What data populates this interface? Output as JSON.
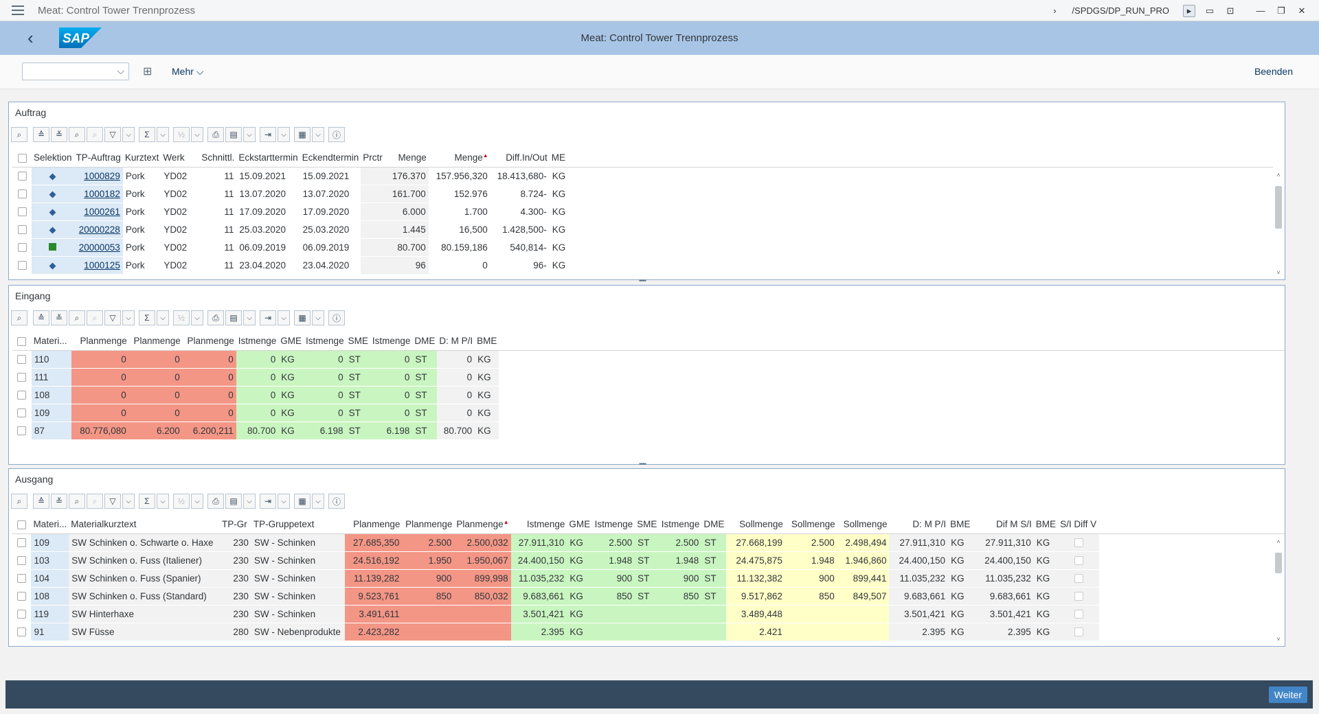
{
  "window": {
    "title": "Meat: Control Tower Trennprozess",
    "transaction": "/SPDGS/DP_RUN_PRO"
  },
  "shell": {
    "app_title": "Meat: Control Tower Trennprozess",
    "logo_text": "SAP"
  },
  "toolbar": {
    "mehr_label": "Mehr",
    "beenden_label": "Beenden"
  },
  "auftrag": {
    "title": "Auftrag",
    "columns": [
      "Selektion",
      "TP-Auftrag",
      "Kurztext",
      "Werk",
      "Schnittl.",
      "Eckstarttermin",
      "Eckendtermin",
      "Prctr",
      "Menge",
      "Menge",
      "Diff.In/Out",
      "ME"
    ],
    "rows": [
      {
        "status": "diamond",
        "tp": "1000829",
        "kurztext": "Pork",
        "werk": "YD02",
        "schnittl": "11",
        "start": "15.09.2021",
        "end": "15.09.2021",
        "prctr": "",
        "menge1": "176.370",
        "menge2": "157.956,320",
        "diff": "18.413,680-",
        "me": "KG"
      },
      {
        "status": "diamond",
        "tp": "1000182",
        "kurztext": "Pork",
        "werk": "YD02",
        "schnittl": "11",
        "start": "13.07.2020",
        "end": "13.07.2020",
        "prctr": "",
        "menge1": "161.700",
        "menge2": "152.976",
        "diff": "8.724-",
        "me": "KG"
      },
      {
        "status": "diamond",
        "tp": "1000261",
        "kurztext": "Pork",
        "werk": "YD02",
        "schnittl": "11",
        "start": "17.09.2020",
        "end": "17.09.2020",
        "prctr": "",
        "menge1": "6.000",
        "menge2": "1.700",
        "diff": "4.300-",
        "me": "KG"
      },
      {
        "status": "diamond",
        "tp": "20000228",
        "kurztext": "Pork",
        "werk": "YD02",
        "schnittl": "11",
        "start": "25.03.2020",
        "end": "25.03.2020",
        "prctr": "",
        "menge1": "1.445",
        "menge2": "16,500",
        "diff": "1.428,500-",
        "me": "KG"
      },
      {
        "status": "square",
        "tp": "20000053",
        "kurztext": "Pork",
        "werk": "YD02",
        "schnittl": "11",
        "start": "06.09.2019",
        "end": "06.09.2019",
        "prctr": "",
        "menge1": "80.700",
        "menge2": "80.159,186",
        "diff": "540,814-",
        "me": "KG"
      },
      {
        "status": "diamond",
        "tp": "1000125",
        "kurztext": "Pork",
        "werk": "YD02",
        "schnittl": "11",
        "start": "23.04.2020",
        "end": "23.04.2020",
        "prctr": "",
        "menge1": "96",
        "menge2": "0",
        "diff": "96-",
        "me": "KG"
      }
    ]
  },
  "eingang": {
    "title": "Eingang",
    "columns": [
      "Materi...",
      "Planmenge",
      "Planmenge",
      "Planmenge",
      "Istmenge",
      "GME",
      "Istmenge",
      "SME",
      "Istmenge",
      "DME",
      "D: M P/I",
      "BME"
    ],
    "rows": [
      {
        "mat": "110",
        "p1": "0",
        "p2": "0",
        "p3": "0",
        "i1": "0",
        "gme": "KG",
        "i2": "0",
        "sme": "ST",
        "i3": "0",
        "dme": "ST",
        "dm": "0",
        "bme": "KG"
      },
      {
        "mat": "111",
        "p1": "0",
        "p2": "0",
        "p3": "0",
        "i1": "0",
        "gme": "KG",
        "i2": "0",
        "sme": "ST",
        "i3": "0",
        "dme": "ST",
        "dm": "0",
        "bme": "KG"
      },
      {
        "mat": "108",
        "p1": "0",
        "p2": "0",
        "p3": "0",
        "i1": "0",
        "gme": "KG",
        "i2": "0",
        "sme": "ST",
        "i3": "0",
        "dme": "ST",
        "dm": "0",
        "bme": "KG"
      },
      {
        "mat": "109",
        "p1": "0",
        "p2": "0",
        "p3": "0",
        "i1": "0",
        "gme": "KG",
        "i2": "0",
        "sme": "ST",
        "i3": "0",
        "dme": "ST",
        "dm": "0",
        "bme": "KG"
      },
      {
        "mat": "87",
        "p1": "80.776,080",
        "p2": "6.200",
        "p3": "6.200,211",
        "i1": "80.700",
        "gme": "KG",
        "i2": "6.198",
        "sme": "ST",
        "i3": "6.198",
        "dme": "ST",
        "dm": "80.700",
        "bme": "KG"
      }
    ]
  },
  "ausgang": {
    "title": "Ausgang",
    "columns": [
      "Materi...",
      "Materialkurztext",
      "TP-Gr",
      "TP-Gruppetext",
      "Planmenge",
      "Planmenge",
      "Planmenge",
      "Istmenge",
      "GME",
      "Istmenge",
      "SME",
      "Istmenge",
      "DME",
      "Sollmenge",
      "Sollmenge",
      "Sollmenge",
      "D: M P/I",
      "BME",
      "Dif M S/I",
      "BME",
      "S/I Diff V"
    ],
    "rows": [
      {
        "mat": "109",
        "text": "SW Schinken o. Schwarte o. Haxe",
        "tpgr": "230",
        "tptext": "SW - Schinken",
        "p1": "27.685,350",
        "p2": "2.500",
        "p3": "2.500,032",
        "i1": "27.911,310",
        "gme": "KG",
        "i2": "2.500",
        "sme": "ST",
        "i3": "2.500",
        "dme": "ST",
        "s1": "27.668,199",
        "s2": "2.500",
        "s3": "2.498,494",
        "dm": "27.911,310",
        "bme": "KG",
        "dif": "27.911,310",
        "bme2": "KG"
      },
      {
        "mat": "103",
        "text": "SW Schinken o. Fuss (Italiener)",
        "tpgr": "230",
        "tptext": "SW - Schinken",
        "p1": "24.516,192",
        "p2": "1.950",
        "p3": "1.950,067",
        "i1": "24.400,150",
        "gme": "KG",
        "i2": "1.948",
        "sme": "ST",
        "i3": "1.948",
        "dme": "ST",
        "s1": "24.475,875",
        "s2": "1.948",
        "s3": "1.946,860",
        "dm": "24.400,150",
        "bme": "KG",
        "dif": "24.400,150",
        "bme2": "KG"
      },
      {
        "mat": "104",
        "text": "SW Schinken o. Fuss (Spanier)",
        "tpgr": "230",
        "tptext": "SW - Schinken",
        "p1": "11.139,282",
        "p2": "900",
        "p3": "899,998",
        "i1": "11.035,232",
        "gme": "KG",
        "i2": "900",
        "sme": "ST",
        "i3": "900",
        "dme": "ST",
        "s1": "11.132,382",
        "s2": "900",
        "s3": "899,441",
        "dm": "11.035,232",
        "bme": "KG",
        "dif": "11.035,232",
        "bme2": "KG"
      },
      {
        "mat": "108",
        "text": "SW Schinken o. Fuss (Standard)",
        "tpgr": "230",
        "tptext": "SW - Schinken",
        "p1": "9.523,761",
        "p2": "850",
        "p3": "850,032",
        "i1": "9.683,661",
        "gme": "KG",
        "i2": "850",
        "sme": "ST",
        "i3": "850",
        "dme": "ST",
        "s1": "9.517,862",
        "s2": "850",
        "s3": "849,507",
        "dm": "9.683,661",
        "bme": "KG",
        "dif": "9.683,661",
        "bme2": "KG"
      },
      {
        "mat": "119",
        "text": "SW Hinterhaxe",
        "tpgr": "230",
        "tptext": "SW - Schinken",
        "p1": "3.491,611",
        "p2": "",
        "p3": "",
        "i1": "3.501,421",
        "gme": "KG",
        "i2": "",
        "sme": "",
        "i3": "",
        "dme": "",
        "s1": "3.489,448",
        "s2": "",
        "s3": "",
        "dm": "3.501,421",
        "bme": "KG",
        "dif": "3.501,421",
        "bme2": "KG"
      },
      {
        "mat": "91",
        "text": "SW Füsse",
        "tpgr": "280",
        "tptext": "SW - Nebenprodukte",
        "p1": "2.423,282",
        "p2": "",
        "p3": "",
        "i1": "2.395",
        "gme": "KG",
        "i2": "",
        "sme": "",
        "i3": "",
        "dme": "",
        "s1": "2.421",
        "s2": "",
        "s3": "",
        "dm": "2.395",
        "bme": "KG",
        "dif": "2.395",
        "bme2": "KG"
      }
    ]
  },
  "footer": {
    "weiter_label": "Weiter"
  }
}
